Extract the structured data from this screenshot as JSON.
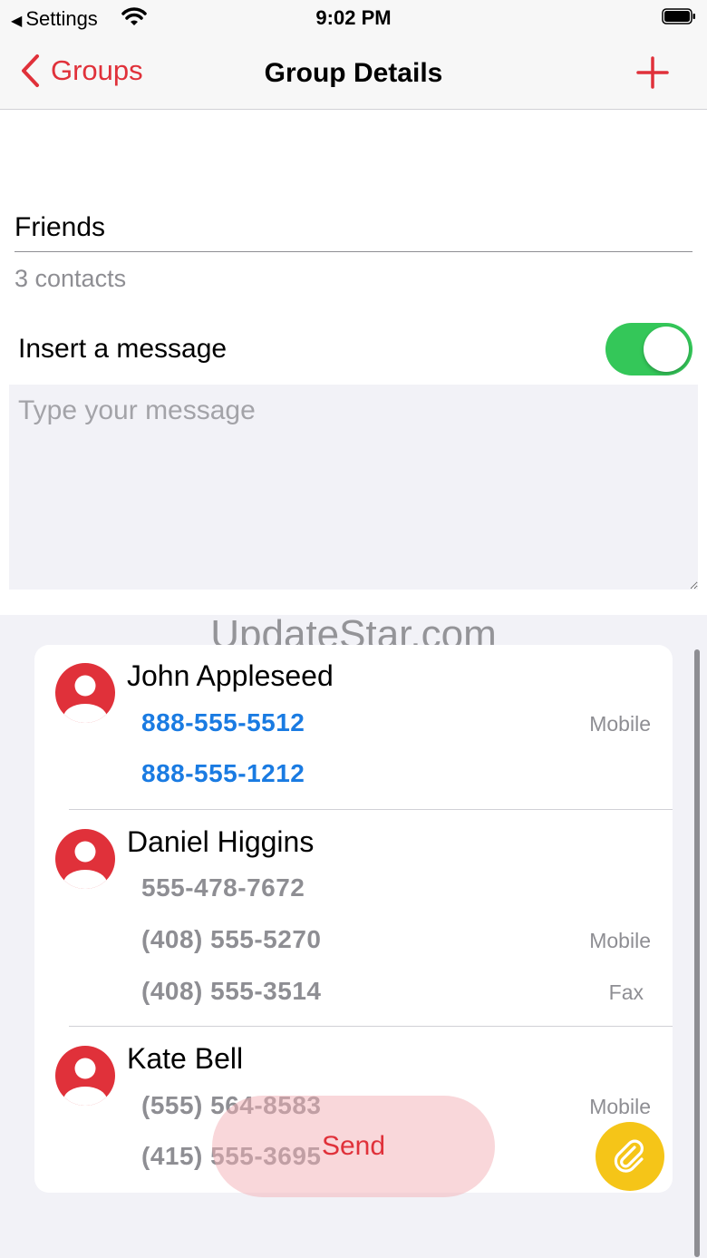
{
  "status_bar": {
    "back_app": "Settings",
    "time": "9:02 PM"
  },
  "nav": {
    "back_label": "Groups",
    "title": "Group Details"
  },
  "group": {
    "name": "Friends",
    "count": "3 contacts"
  },
  "message": {
    "toggle_label": "Insert a message",
    "toggle_on": true,
    "placeholder": "Type your message"
  },
  "watermark": "UpdateStar.com",
  "contacts": [
    {
      "name": "John Appleseed",
      "phones": [
        {
          "number": "888-555-5512",
          "type": "Mobile"
        },
        {
          "number": "888-555-1212",
          "type": ""
        }
      ]
    },
    {
      "name": "Daniel Higgins",
      "phones": [
        {
          "number": "555-478-7672",
          "type": ""
        },
        {
          "number": "(408) 555-5270",
          "type": "Mobile"
        },
        {
          "number": "(408) 555-3514",
          "type": "Fax"
        }
      ]
    },
    {
      "name": "Kate Bell",
      "phones": [
        {
          "number": "(555) 564-8583",
          "type": "Mobile"
        },
        {
          "number": "(415) 555-3695",
          "type": ""
        }
      ]
    }
  ],
  "actions": {
    "send_label": "Send"
  },
  "colors": {
    "accent": "#e0313a",
    "toggle_on": "#34c759",
    "link_blue": "#1a7be2",
    "attach": "#f5c518"
  },
  "icons": {
    "back": "chevron-left-icon",
    "add": "plus-icon",
    "avatar": "person-icon",
    "attach": "paperclip-icon"
  }
}
